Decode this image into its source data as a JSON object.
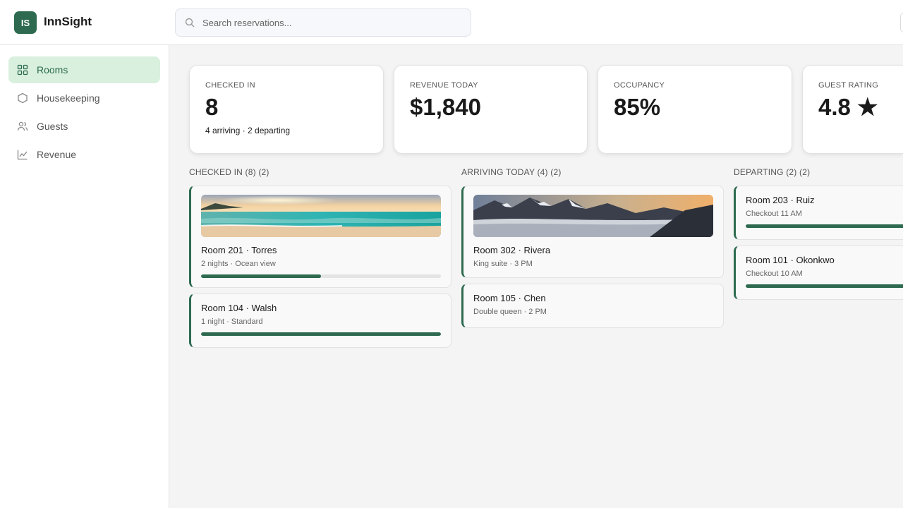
{
  "app": {
    "logo_initials": "IS",
    "name": "InnSight"
  },
  "search": {
    "placeholder": "Search reservations..."
  },
  "sidebar": {
    "items": [
      {
        "label": "Rooms",
        "icon": "grid-icon",
        "active": true
      },
      {
        "label": "Housekeeping",
        "icon": "hexagon-icon",
        "active": false
      },
      {
        "label": "Guests",
        "icon": "users-icon",
        "active": false
      },
      {
        "label": "Revenue",
        "icon": "line-chart-icon",
        "active": false
      }
    ]
  },
  "stats": [
    {
      "label": "CHECKED IN",
      "value": "8",
      "sub": "4 arriving · 2 departing"
    },
    {
      "label": "REVENUE TODAY",
      "value": "$1,840",
      "sub": ""
    },
    {
      "label": "OCCUPANCY",
      "value": "85%",
      "sub": ""
    },
    {
      "label": "GUEST RATING",
      "value": "4.8 ★",
      "sub": ""
    }
  ],
  "columns": [
    {
      "title": "CHECKED IN (8) (2)",
      "cards": [
        {
          "title": "Room 201 · Torres",
          "subtitle": "2 nights · Ocean view",
          "image": "ocean-beach-photo",
          "progress": 0.5
        },
        {
          "title": "Room 104 · Walsh",
          "subtitle": "1 night · Standard",
          "progress": 1.0
        }
      ]
    },
    {
      "title": "ARRIVING TODAY (4) (2)",
      "cards": [
        {
          "title": "Room 302 · Rivera",
          "subtitle": "King suite · 3 PM",
          "image": "mountain-range-photo"
        },
        {
          "title": "Room 105 · Chen",
          "subtitle": "Double queen · 2 PM"
        }
      ]
    },
    {
      "title": "DEPARTING (2) (2)",
      "cards": [
        {
          "title": "Room 203 · Ruiz",
          "subtitle": "Checkout 11 AM",
          "progress": 1.0
        },
        {
          "title": "Room 101 · Okonkwo",
          "subtitle": "Checkout 10 AM",
          "progress": 1.0
        }
      ]
    }
  ],
  "colors": {
    "accent": "#2d6a4f",
    "accent_light": "#d8f0dd",
    "background": "#f4f4f4"
  }
}
